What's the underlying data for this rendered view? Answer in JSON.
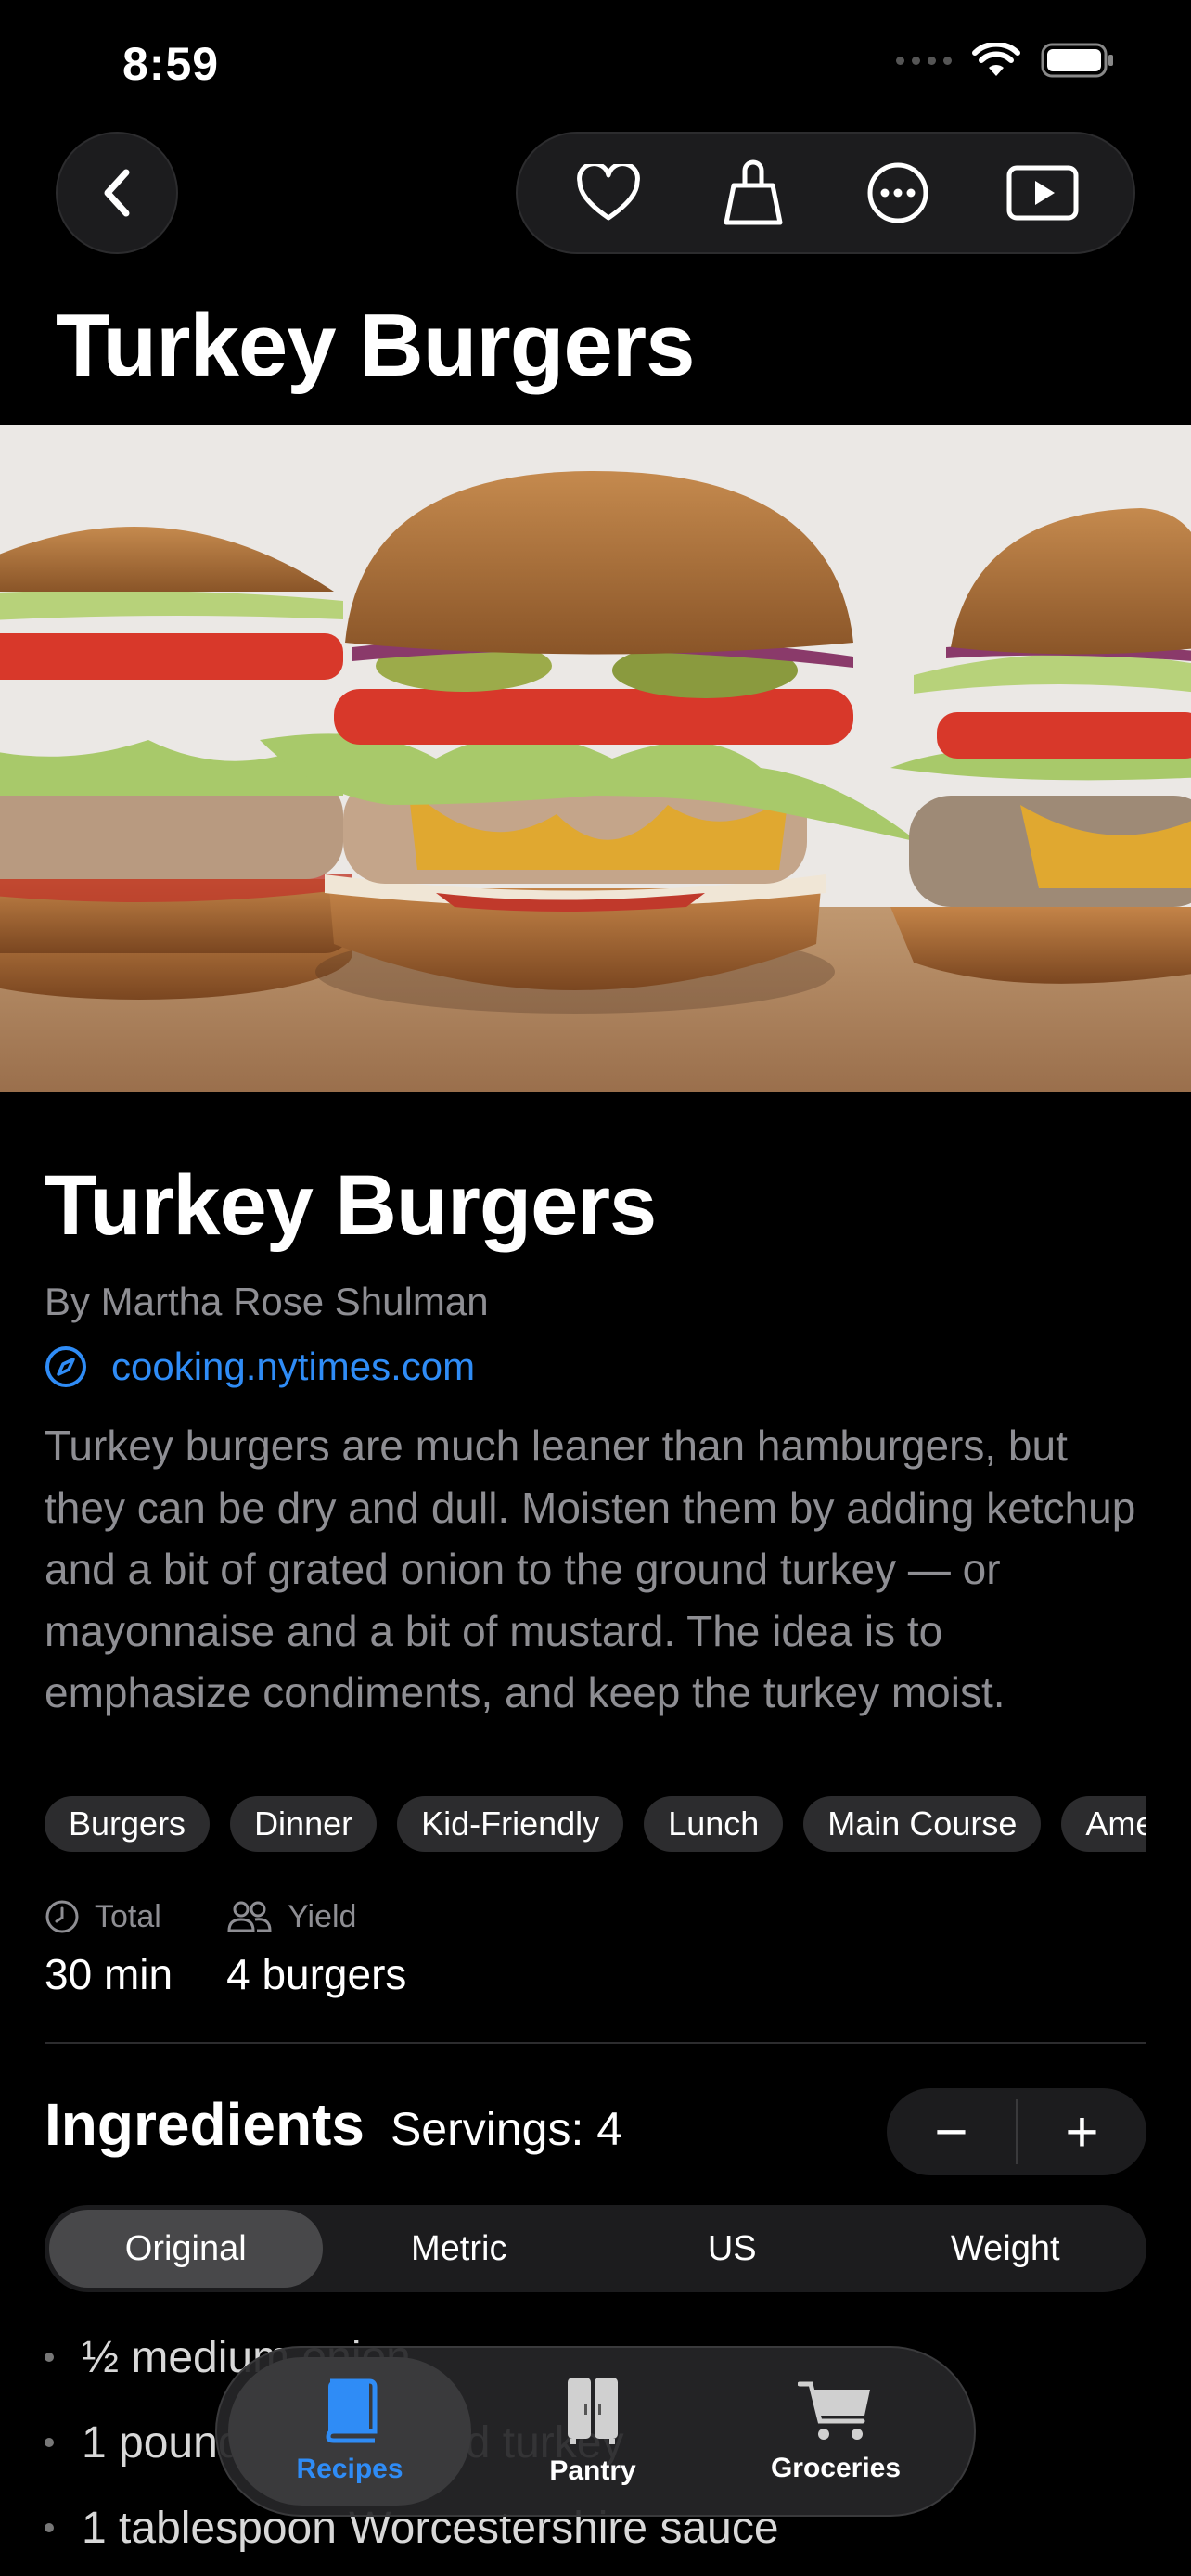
{
  "status_bar": {
    "time": "8:59"
  },
  "nav": {
    "title": "Turkey Burgers",
    "actions": [
      {
        "icon": "heart-icon"
      },
      {
        "icon": "shopping-bag-icon"
      },
      {
        "icon": "more-icon"
      },
      {
        "icon": "play-icon"
      }
    ]
  },
  "recipe": {
    "title": "Turkey Burgers",
    "author": "By Martha Rose Shulman",
    "source": "cooking.nytimes.com",
    "description": "Turkey burgers are much leaner than hamburgers, but they can be dry and dull. Moisten them by adding ketchup and a bit of grated onion to the ground turkey — or mayonnaise and a bit of mustard. The idea is to emphasize condiments, and keep the turkey moist.",
    "tags": [
      "Burgers",
      "Dinner",
      "Kid-Friendly",
      "Lunch",
      "Main Course",
      "American"
    ],
    "total_label": "Total",
    "total_value": "30 min",
    "yield_label": "Yield",
    "yield_value": "4 burgers"
  },
  "ingredients": {
    "title": "Ingredients",
    "servings": "Servings: 4",
    "stepper_minus": "−",
    "stepper_plus": "+",
    "units": [
      "Original",
      "Metric",
      "US",
      "Weight"
    ],
    "active_unit": "Original",
    "items": [
      "½ medium onion",
      "1 pound lean ground turkey",
      "1 tablespoon Worcestershire sauce"
    ]
  },
  "tab_bar": {
    "tabs": [
      {
        "label": "Recipes",
        "icon": "book-icon",
        "active": true
      },
      {
        "label": "Pantry",
        "icon": "pantry-icon",
        "active": false
      },
      {
        "label": "Groceries",
        "icon": "cart-icon",
        "active": false
      }
    ]
  },
  "colors": {
    "accent": "#2f8cf6",
    "background": "#000000",
    "surface": "#1c1c1e",
    "secondary_text": "#8e8e93"
  }
}
